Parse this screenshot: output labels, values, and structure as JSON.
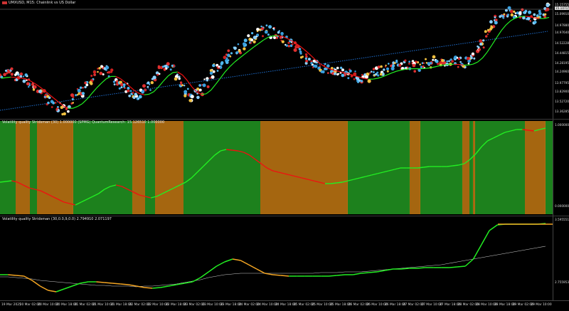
{
  "main_pane": {
    "title": "UMXUSD, M15:  Chainlink vs US Dollar",
    "flag_icon": "red-flag-icon",
    "price_labels": [
      "15.15755",
      "15.10715",
      "15.09910",
      "14.97880",
      "14.97640",
      "14.52228",
      "14.44815",
      "14.28195",
      "14.24960",
      "13.97795",
      "13.82900",
      "13.52720",
      "13.36285"
    ],
    "current_price": "15.10715"
  },
  "indicator1": {
    "title": "Volatility quality Stridsman (30) 1.000000 (SPMG)  QuantumResearch: 15.126510 1.000000",
    "labels": [
      "1.000000",
      "0.000000"
    ]
  },
  "indicator2": {
    "title": "Volatility quality Stridsman (30,0.0,9,0.0) 2.794910 2.071197",
    "labels": [
      "3.595551",
      "2.755953"
    ]
  },
  "time_axis": [
    "19 Mar 2025",
    "20 Mar 02:00",
    "20 Mar 10:00",
    "20 Mar 18:00",
    "21 Mar 02:00",
    "21 Mar 10:00",
    "21 Mar 18:00",
    "22 Mar 02:00",
    "22 Mar 10:00",
    "22 Mar 18:00",
    "23 Mar 02:00",
    "23 Mar 10:00",
    "23 Mar 18:00",
    "24 Mar 02:00",
    "24 Mar 10:00",
    "24 Mar 18:00",
    "25 Mar 02:00",
    "25 Mar 10:00",
    "25 Mar 18:00",
    "26 Mar 02:00",
    "26 Mar 10:00",
    "26 Mar 18:00",
    "27 Mar 02:00",
    "27 Mar 10:00",
    "27 Mar 18:00",
    "28 Mar 02:00",
    "28 Mar 10:00",
    "28 Mar 18:00",
    "29 Mar 02:00",
    "29 Mar 10:00"
  ],
  "colors": {
    "up_band": "#1f8a1f",
    "down_band": "#b06d12",
    "up_line": "#22ee22",
    "down_line": "#ee1111",
    "trend_dotted": "#1e6fd0",
    "signal_line": "#cccccc",
    "orange_line": "#f5a623"
  }
}
